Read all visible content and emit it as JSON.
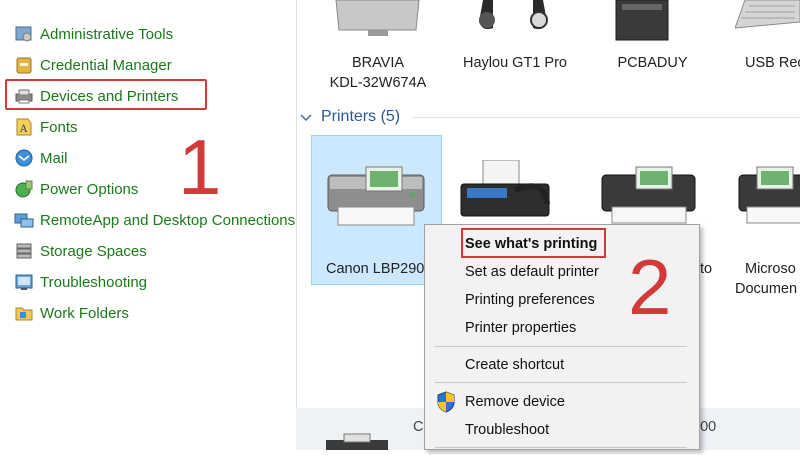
{
  "sidebar": {
    "items": [
      {
        "label": "Administrative Tools",
        "icon": "admin-tools-icon"
      },
      {
        "label": "Credential Manager",
        "icon": "credential-manager-icon"
      },
      {
        "label": "Devices and Printers",
        "icon": "devices-printers-icon"
      },
      {
        "label": "Fonts",
        "icon": "fonts-icon"
      },
      {
        "label": "Mail",
        "icon": "mail-icon"
      },
      {
        "label": "Power Options",
        "icon": "power-options-icon"
      },
      {
        "label": "RemoteApp and Desktop Connections",
        "icon": "remoteapp-icon"
      },
      {
        "label": "Storage Spaces",
        "icon": "storage-spaces-icon"
      },
      {
        "label": "Troubleshooting",
        "icon": "troubleshooting-icon"
      },
      {
        "label": "Work Folders",
        "icon": "work-folders-icon"
      }
    ]
  },
  "annotations": {
    "step1": "1",
    "step2": "2",
    "highlight_color": "#d23a3a"
  },
  "devices": {
    "items": [
      {
        "line1": "BRAVIA",
        "line2": "KDL-32W674A"
      },
      {
        "line1": "Haylou GT1 Pro"
      },
      {
        "line1": "PCBADUY"
      },
      {
        "line1": "USB Rec"
      }
    ]
  },
  "printers": {
    "header": "Printers (5)",
    "items": [
      {
        "label": "Canon LBP290"
      },
      {
        "label": "to"
      },
      {
        "line1": "Microso",
        "line2": "Documen"
      }
    ]
  },
  "context_menu": {
    "items": [
      {
        "label": "See what's printing"
      },
      {
        "label": "Set as default printer"
      },
      {
        "label": "Printing preferences"
      },
      {
        "label": "Printer properties"
      },
      {
        "label": "Create shortcut"
      },
      {
        "label": "Remove device"
      },
      {
        "label": "Troubleshoot"
      }
    ]
  },
  "bottom_row": {
    "left": "C",
    "right": "900"
  }
}
